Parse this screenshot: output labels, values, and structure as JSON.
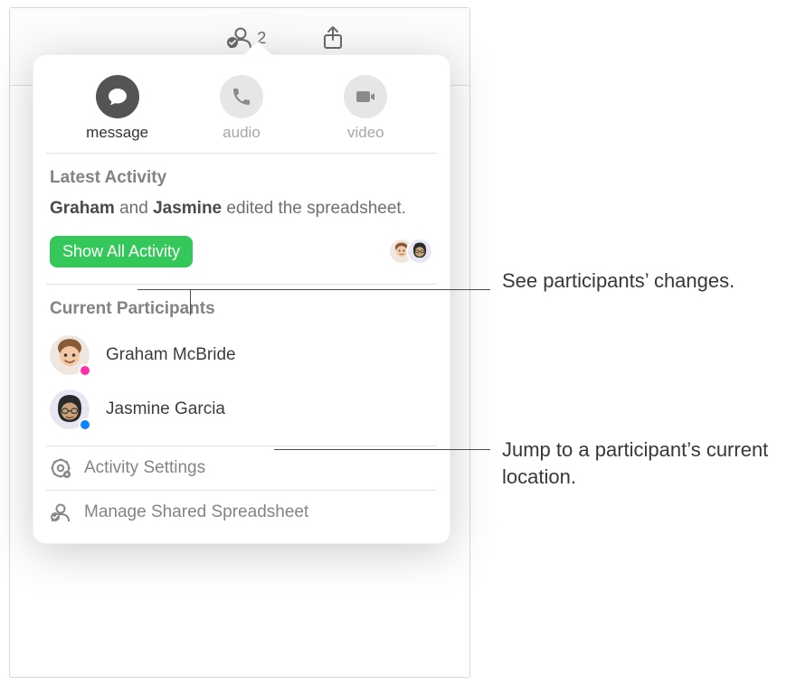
{
  "toolbar": {
    "collaboration": {
      "label": "Collaboration",
      "count": "2"
    },
    "share": {
      "label": "Share"
    }
  },
  "contact_actions": {
    "message": "message",
    "audio": "audio",
    "video": "video"
  },
  "latest_activity": {
    "header": "Latest Activity",
    "person1": "Graham",
    "joiner": " and ",
    "person2": "Jasmine",
    "rest": " edited the spreadsheet.",
    "show_all_label": "Show All Activity"
  },
  "participants": {
    "header": "Current Participants",
    "list": [
      {
        "name": "Graham McBride",
        "status_color": "#ff2ea6"
      },
      {
        "name": "Jasmine Garcia",
        "status_color": "#0a84ff"
      }
    ]
  },
  "footer": {
    "settings": "Activity Settings",
    "manage": "Manage Shared Spreadsheet"
  },
  "callouts": {
    "changes": "See participants’ changes.",
    "jump": "Jump to a participant’s current location."
  }
}
